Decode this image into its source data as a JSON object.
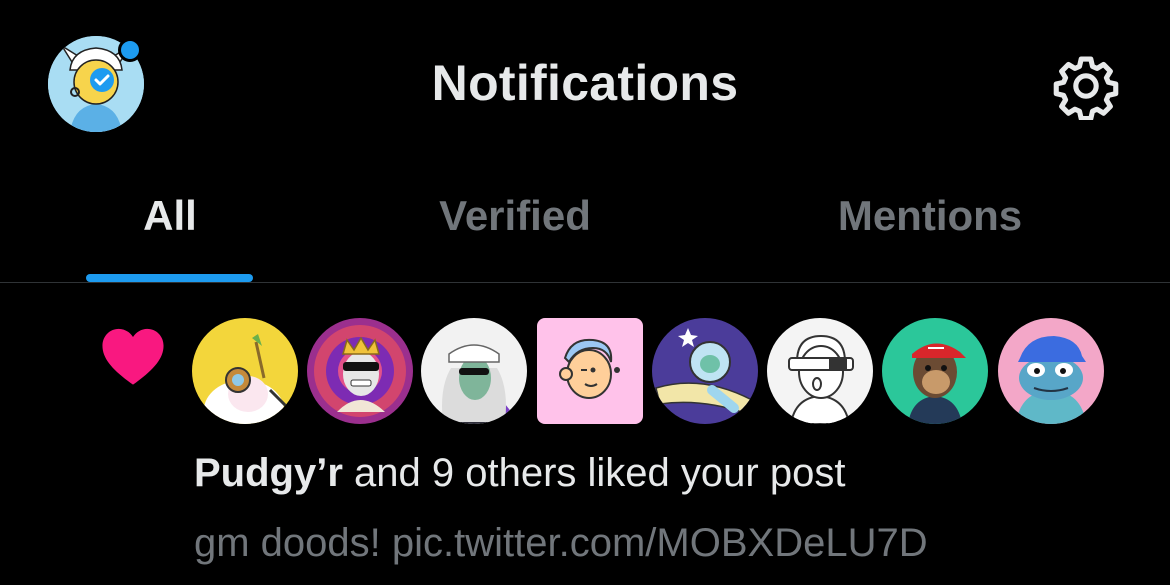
{
  "header": {
    "title": "Notifications",
    "avatar_icon": "profile-avatar",
    "settings_icon": "gear-icon",
    "has_unread_dot": true
  },
  "tabs": [
    {
      "label": "All",
      "active": true
    },
    {
      "label": "Verified",
      "active": false
    },
    {
      "label": "Mentions",
      "active": false
    }
  ],
  "notification": {
    "type_icon": "heart-icon",
    "actor": "Pudgy’r",
    "action_text": " and 9 others liked your post",
    "post_preview": "gm doods! pic.twitter.com/MOBXDeLU7D",
    "liker_avatars_count": 8
  },
  "colors": {
    "background": "#000000",
    "accent": "#1d9bf0",
    "like": "#f91880",
    "primary_text": "#e7e9ea",
    "secondary_text": "#71767b"
  }
}
